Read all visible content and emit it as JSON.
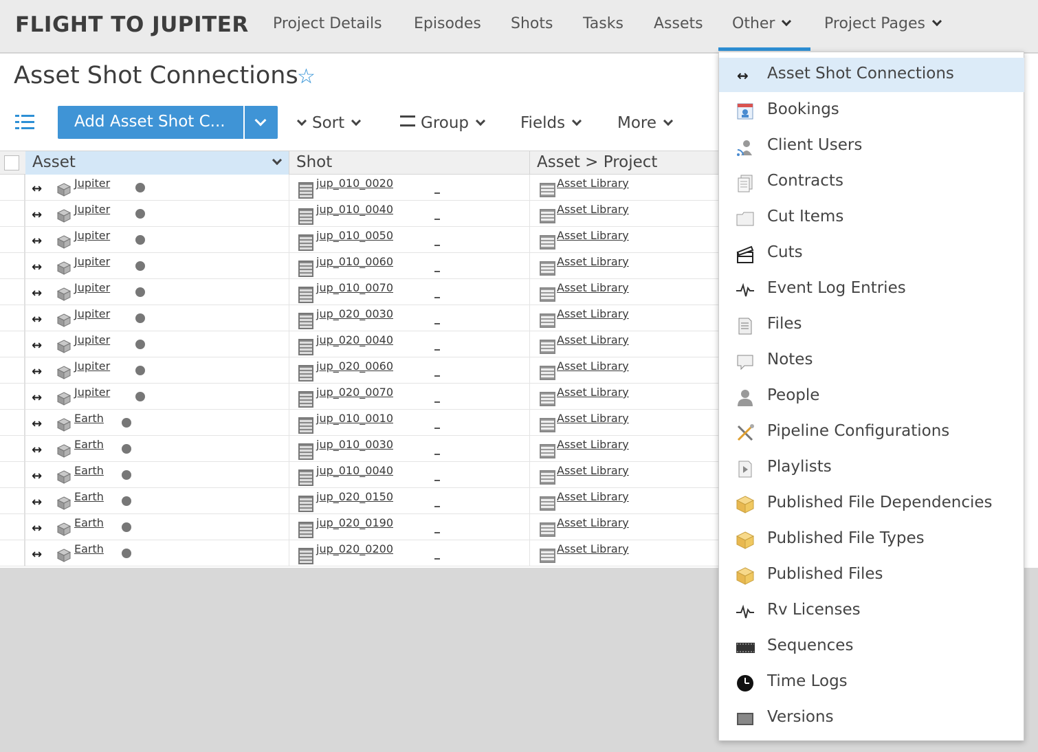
{
  "nav": {
    "brand": "FLIGHT TO JUPITER",
    "items": [
      {
        "label": "Project Details"
      },
      {
        "label": "Episodes"
      },
      {
        "label": "Shots"
      },
      {
        "label": "Tasks"
      },
      {
        "label": "Assets"
      },
      {
        "label": "Other"
      },
      {
        "label": "Project Pages"
      }
    ]
  },
  "page": {
    "title": "Asset Shot Connections"
  },
  "toolbar": {
    "add_label": "Add Asset Shot C...",
    "sort": "Sort",
    "group": "Group",
    "fields": "Fields",
    "more": "More"
  },
  "grid": {
    "columns": [
      "Asset",
      "Shot",
      "Asset > Project"
    ],
    "rows": [
      {
        "asset": "Jupiter",
        "shot": "jup_010_0020",
        "project": "Asset Library"
      },
      {
        "asset": "Jupiter",
        "shot": "jup_010_0040",
        "project": "Asset Library"
      },
      {
        "asset": "Jupiter",
        "shot": "jup_010_0050",
        "project": "Asset Library"
      },
      {
        "asset": "Jupiter",
        "shot": "jup_010_0060",
        "project": "Asset Library"
      },
      {
        "asset": "Jupiter",
        "shot": "jup_010_0070",
        "project": "Asset Library"
      },
      {
        "asset": "Jupiter",
        "shot": "jup_020_0030",
        "project": "Asset Library"
      },
      {
        "asset": "Jupiter",
        "shot": "jup_020_0040",
        "project": "Asset Library"
      },
      {
        "asset": "Jupiter",
        "shot": "jup_020_0060",
        "project": "Asset Library"
      },
      {
        "asset": "Jupiter",
        "shot": "jup_020_0070",
        "project": "Asset Library"
      },
      {
        "asset": "Earth",
        "shot": "jup_010_0010",
        "project": "Asset Library"
      },
      {
        "asset": "Earth",
        "shot": "jup_010_0030",
        "project": "Asset Library"
      },
      {
        "asset": "Earth",
        "shot": "jup_010_0040",
        "project": "Asset Library"
      },
      {
        "asset": "Earth",
        "shot": "jup_020_0150",
        "project": "Asset Library"
      },
      {
        "asset": "Earth",
        "shot": "jup_020_0190",
        "project": "Asset Library"
      },
      {
        "asset": "Earth",
        "shot": "jup_020_0200",
        "project": "Asset Library"
      }
    ]
  },
  "menu": {
    "items": [
      {
        "label": "Asset Shot Connections",
        "icon": "connection-icon",
        "active": true
      },
      {
        "label": "Bookings",
        "icon": "calendar-icon"
      },
      {
        "label": "Client Users",
        "icon": "client-user-icon"
      },
      {
        "label": "Contracts",
        "icon": "contracts-icon"
      },
      {
        "label": "Cut Items",
        "icon": "folder-icon"
      },
      {
        "label": "Cuts",
        "icon": "clapperboard-icon"
      },
      {
        "label": "Event Log Entries",
        "icon": "pulse-icon"
      },
      {
        "label": "Files",
        "icon": "file-icon"
      },
      {
        "label": "Notes",
        "icon": "note-icon"
      },
      {
        "label": "People",
        "icon": "person-icon"
      },
      {
        "label": "Pipeline Configurations",
        "icon": "tools-icon"
      },
      {
        "label": "Playlists",
        "icon": "playlist-icon"
      },
      {
        "label": "Published File Dependencies",
        "icon": "package-icon"
      },
      {
        "label": "Published File Types",
        "icon": "package-icon"
      },
      {
        "label": "Published Files",
        "icon": "package-icon"
      },
      {
        "label": "Rv Licenses",
        "icon": "pulse-icon"
      },
      {
        "label": "Sequences",
        "icon": "filmstrip-icon"
      },
      {
        "label": "Time Logs",
        "icon": "clock-icon"
      },
      {
        "label": "Versions",
        "icon": "version-icon"
      }
    ]
  },
  "colors": {
    "accent": "#3f94d6",
    "nav_bg": "#ebebeb",
    "menu_active": "#dcebf8"
  }
}
